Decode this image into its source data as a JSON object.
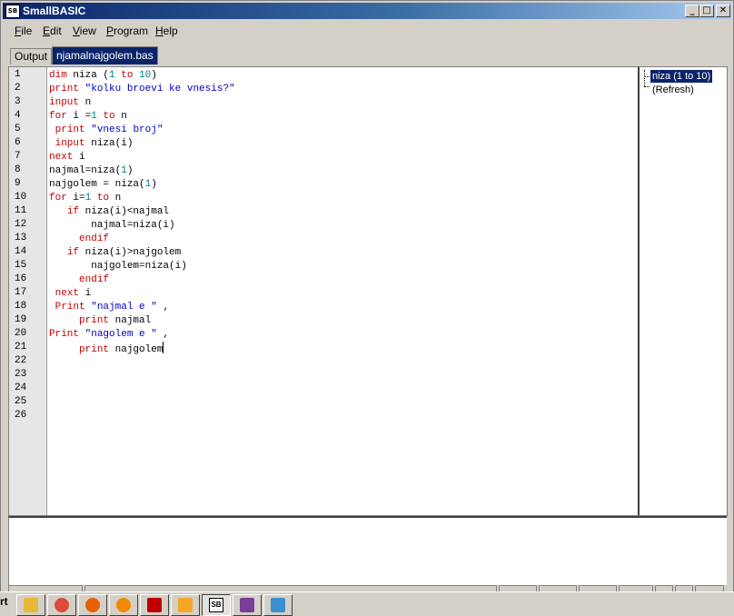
{
  "window": {
    "title": "SmallBASIC",
    "app_icon_text": "SB"
  },
  "menu": [
    {
      "label": "File",
      "key": "F",
      "rest": "ile"
    },
    {
      "label": "Edit",
      "key": "E",
      "rest": "dit"
    },
    {
      "label": "View",
      "key": "V",
      "rest": "iew"
    },
    {
      "label": "Program",
      "key": "P",
      "rest": "rogram"
    },
    {
      "label": "Help",
      "key": "H",
      "rest": "elp"
    }
  ],
  "tabs": [
    {
      "label": "Output",
      "active": false
    },
    {
      "label": "njamalnajgolem.bas",
      "active": true
    }
  ],
  "editor": {
    "line_numbers": [
      "1",
      "2",
      "3",
      "4",
      "5",
      "6",
      "7",
      "8",
      "9",
      "10",
      "11",
      "12",
      "13",
      "14",
      "15",
      "16",
      "17",
      "18",
      "19",
      "20",
      "21",
      "22",
      "23",
      "24",
      "25",
      "26"
    ],
    "lines": [
      [
        {
          "t": "kw",
          "v": "dim"
        },
        {
          "t": "tx",
          "v": " niza ("
        },
        {
          "t": "nm",
          "v": "1"
        },
        {
          "t": "tx",
          "v": " "
        },
        {
          "t": "kw",
          "v": "to"
        },
        {
          "t": "tx",
          "v": " "
        },
        {
          "t": "nm",
          "v": "10"
        },
        {
          "t": "tx",
          "v": ")"
        }
      ],
      [
        {
          "t": "kw",
          "v": "print"
        },
        {
          "t": "tx",
          "v": " "
        },
        {
          "t": "st",
          "v": "\"kolku broevi ke vnesis?\""
        }
      ],
      [
        {
          "t": "kw",
          "v": "input"
        },
        {
          "t": "tx",
          "v": " n"
        }
      ],
      [
        {
          "t": "kw",
          "v": "for"
        },
        {
          "t": "tx",
          "v": " i ="
        },
        {
          "t": "nm",
          "v": "1"
        },
        {
          "t": "tx",
          "v": " "
        },
        {
          "t": "kw",
          "v": "to"
        },
        {
          "t": "tx",
          "v": " n"
        }
      ],
      [
        {
          "t": "tx",
          "v": " "
        },
        {
          "t": "kw",
          "v": "print"
        },
        {
          "t": "tx",
          "v": " "
        },
        {
          "t": "st",
          "v": "\"vnesi broj\""
        }
      ],
      [
        {
          "t": "tx",
          "v": " "
        },
        {
          "t": "kw",
          "v": "input"
        },
        {
          "t": "tx",
          "v": " niza(i)"
        }
      ],
      [
        {
          "t": "kw",
          "v": "next"
        },
        {
          "t": "tx",
          "v": " i"
        }
      ],
      [
        {
          "t": "tx",
          "v": "najmal=niza("
        },
        {
          "t": "nm",
          "v": "1"
        },
        {
          "t": "tx",
          "v": ")"
        }
      ],
      [
        {
          "t": "tx",
          "v": "najgolem = niza("
        },
        {
          "t": "nm",
          "v": "1"
        },
        {
          "t": "tx",
          "v": ")"
        }
      ],
      [
        {
          "t": "kw",
          "v": "for"
        },
        {
          "t": "tx",
          "v": " i="
        },
        {
          "t": "nm",
          "v": "1"
        },
        {
          "t": "tx",
          "v": " "
        },
        {
          "t": "kw",
          "v": "to"
        },
        {
          "t": "tx",
          "v": " n"
        }
      ],
      [
        {
          "t": "tx",
          "v": "   "
        },
        {
          "t": "kw",
          "v": "if"
        },
        {
          "t": "tx",
          "v": " niza(i)<najmal"
        }
      ],
      [
        {
          "t": "tx",
          "v": "       najmal=niza(i)"
        }
      ],
      [
        {
          "t": "tx",
          "v": "     "
        },
        {
          "t": "kw",
          "v": "endif"
        }
      ],
      [
        {
          "t": "tx",
          "v": "   "
        },
        {
          "t": "kw",
          "v": "if"
        },
        {
          "t": "tx",
          "v": " niza(i)>najgolem"
        }
      ],
      [
        {
          "t": "tx",
          "v": "       najgolem=niza(i)"
        }
      ],
      [
        {
          "t": "tx",
          "v": "     "
        },
        {
          "t": "kw",
          "v": "endif"
        }
      ],
      [
        {
          "t": "tx",
          "v": " "
        },
        {
          "t": "kw",
          "v": "next"
        },
        {
          "t": "tx",
          "v": " i"
        }
      ],
      [
        {
          "t": "tx",
          "v": " "
        },
        {
          "t": "kw",
          "v": "Print"
        },
        {
          "t": "tx",
          "v": " "
        },
        {
          "t": "st",
          "v": "\"najmal e \""
        },
        {
          "t": "tx",
          "v": " ,"
        }
      ],
      [
        {
          "t": "tx",
          "v": "     "
        },
        {
          "t": "kw",
          "v": "print"
        },
        {
          "t": "tx",
          "v": " najmal"
        }
      ],
      [
        {
          "t": "kw",
          "v": "Print"
        },
        {
          "t": "tx",
          "v": " "
        },
        {
          "t": "st",
          "v": "\"nagolem e \""
        },
        {
          "t": "tx",
          "v": " ,"
        }
      ],
      [
        {
          "t": "tx",
          "v": "     "
        },
        {
          "t": "kw",
          "v": "print"
        },
        {
          "t": "tx",
          "v": " najgolem"
        }
      ]
    ]
  },
  "side_panel": {
    "items": [
      {
        "label": "niza (1 to 10)",
        "selected": true
      },
      {
        "label": "(Refresh)",
        "selected": false
      }
    ]
  },
  "taskbar": {
    "start_fragment": "rt",
    "buttons": [
      {
        "icon": "file-explorer-icon",
        "color": "#e8b838"
      },
      {
        "icon": "chrome-icon",
        "color": "#dd4b39"
      },
      {
        "icon": "firefox-icon",
        "color": "#e66000"
      },
      {
        "icon": "gear-app-icon",
        "color": "#f08a00"
      },
      {
        "icon": "acrobat-icon",
        "color": "#c00000"
      },
      {
        "icon": "scratch-cat-icon",
        "color": "#f5a623"
      },
      {
        "icon": "smallbasic-icon",
        "color": "#000000",
        "label": "SB",
        "pressed": true
      },
      {
        "icon": "winrar-icon",
        "color": "#7a3d9a"
      },
      {
        "icon": "paint-icon",
        "color": "#3c8fd0"
      }
    ]
  }
}
